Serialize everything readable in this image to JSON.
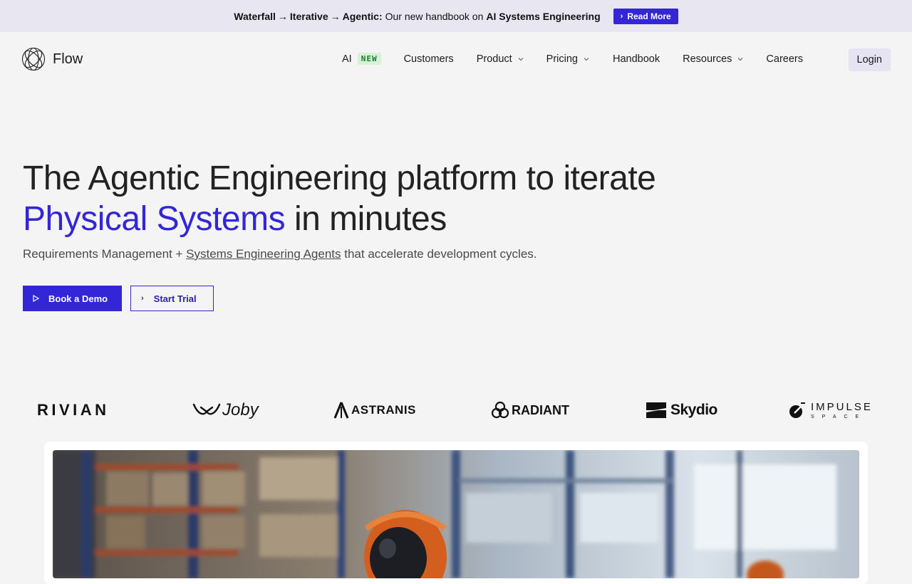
{
  "announcement": {
    "part1": "Waterfall",
    "arrow1": "→",
    "part2": "Iterative",
    "arrow2": "→",
    "part3": "Agentic:",
    "text": "Our new handbook on",
    "highlight": "AI Systems Engineering",
    "cta": "Read More"
  },
  "nav": {
    "brand": "Flow",
    "items": [
      {
        "label": "AI",
        "badge": "NEW"
      },
      {
        "label": "Customers"
      },
      {
        "label": "Product"
      },
      {
        "label": "Pricing"
      },
      {
        "label": "Handbook"
      },
      {
        "label": "Resources"
      },
      {
        "label": "Careers"
      }
    ],
    "login": "Login"
  },
  "hero": {
    "title_line1": "The Agentic Engineering platform to iterate",
    "title_accent": "Physical Systems",
    "title_rest": " in minutes",
    "subtitle_pre": "Requirements Management + ",
    "subtitle_link": "Systems Engineering Agents",
    "subtitle_post": " that accelerate development cycles.",
    "primary_cta": "Book a Demo",
    "secondary_cta": "Start Trial"
  },
  "customers": {
    "logos": [
      "RIVIAN",
      "Joby",
      "ASTRANIS",
      "RADIANT",
      "Skydio",
      "IMPULSE",
      "SPACE"
    ]
  },
  "colors": {
    "accent": "#3326d6",
    "background": "#f4f4f4",
    "announce_bg": "#e8e6f0",
    "badge_bg": "#d6f2d6",
    "badge_text": "#1f7a34"
  }
}
